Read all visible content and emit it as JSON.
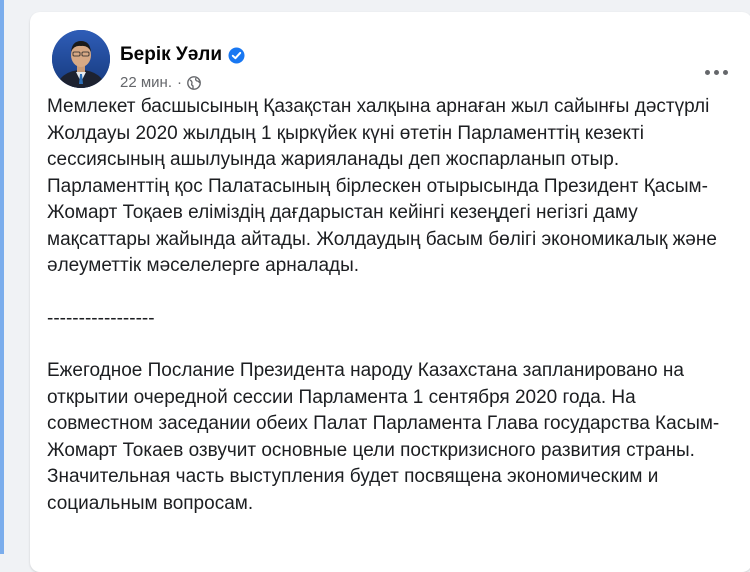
{
  "post": {
    "author": "Берік Уәли",
    "time": "22 мин.",
    "separator_dot": "·",
    "paragraphs": [
      "Мемлекет басшысының Қазақстан халқына арнаған жыл сайынғы дәстүрлі Жолдауы 2020 жылдың 1 қыркүйек күні өтетін Парламенттің кезекті сессиясының ашылуында жарияланады деп жоспарланып отыр. Парламенттің қос Палатасының бірлескен отырысында Президент Қасым-Жомарт Тоқаев еліміздің дағдарыстан кейінгі кезеңдегі негізгі даму мақсаттары жайында айтады. Жолдаудың басым бөлігі экономикалық және әлеуметтік мәселелерге арналады.",
      "-----------------",
      "Ежегодное Послание Президента народу Казахстана запланировано на открытии очередной сессии Парламента 1 сентября 2020 года. На совместном заседании обеих Палат Парламента Глава государства Касым-Жомарт Токаев озвучит основные цели посткризисного развития страны. Значительная часть выступления будет посвящена экономическим и социальным вопросам."
    ]
  },
  "icons": {
    "verified": "verified-badge-icon",
    "audience": "globe-icon",
    "more": "more-options-icon"
  },
  "colors": {
    "accent": "#1b74e4",
    "verified": "#1877f2",
    "text": "#1c1e21",
    "muted": "#65676b",
    "background": "#f0f2f5"
  }
}
